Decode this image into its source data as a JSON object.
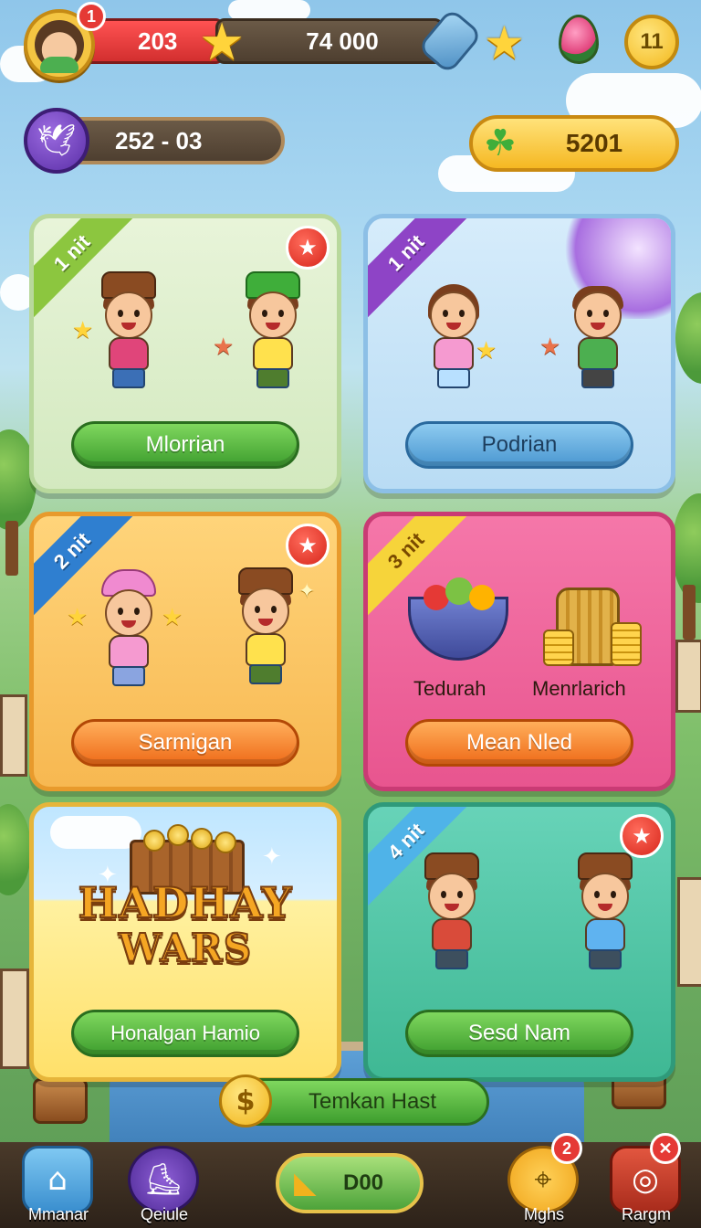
{
  "colors": {
    "accent_green": "#3e9e2e",
    "accent_blue": "#4a97d1",
    "accent_orange": "#ef6c1a",
    "badge_red": "#e53935",
    "coin_gold": "#f5b822"
  },
  "top_bar": {
    "avatar_badge": "1",
    "hp_value": "203",
    "coins_value": "74 000",
    "level_value": "11",
    "icons": [
      "avatar-icon",
      "star-icon",
      "bottle-icon",
      "gem-icon"
    ]
  },
  "secondary_bar": {
    "dove_value": "252 - 03",
    "clover_value": "5201",
    "icons": [
      "dove-icon",
      "clover-icon"
    ]
  },
  "cards": [
    {
      "ribbon": "1 nit",
      "button": "Mlorrian",
      "has_star_badge": true
    },
    {
      "ribbon": "1 nit",
      "button": "Podrian",
      "has_star_badge": false
    },
    {
      "ribbon": "2 nit",
      "button": "Sarmigan",
      "has_star_badge": true
    },
    {
      "ribbon": "3 nit",
      "button": "Mean Nled",
      "item_left": "Tedurah",
      "item_right": "Menrlarich"
    },
    {
      "logo_line1": "HADHAY",
      "logo_line2": "WARS",
      "button": "Honalgan Hamio"
    },
    {
      "ribbon": "4 nit",
      "button": "Sesd Nam",
      "has_star_badge": true
    }
  ],
  "promo_button": {
    "label": "Temkan Hast",
    "icon": "dollar-icon"
  },
  "navbar": {
    "items": [
      {
        "label": "Mmanar",
        "icon": "home-icon"
      },
      {
        "label": "Qeiule",
        "icon": "boot-icon"
      },
      {
        "label": "Mghs",
        "icon": "map-icon",
        "badge": "2"
      },
      {
        "label": "Rargm",
        "icon": "target-icon",
        "badge": "✕"
      }
    ],
    "center_button": {
      "label": "D00",
      "icon": "ticket-icon"
    }
  }
}
